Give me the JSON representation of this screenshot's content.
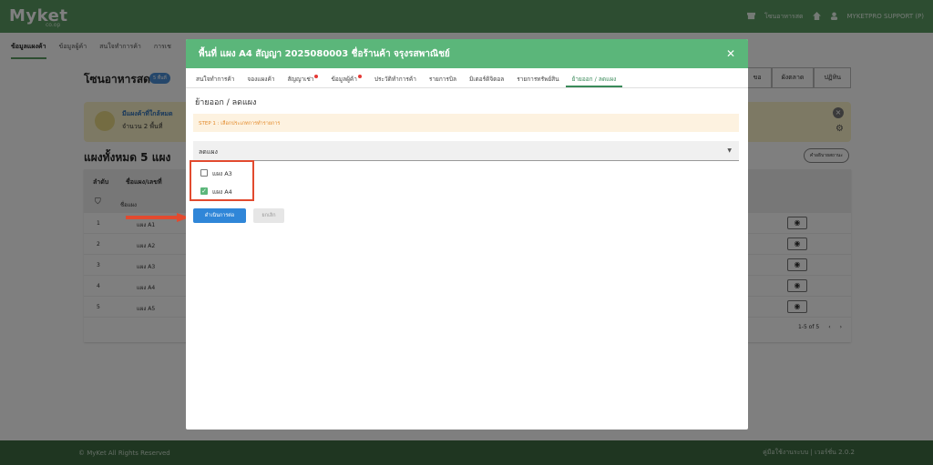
{
  "header": {
    "logo": "Myket",
    "logo_sub": "co.op",
    "shop_label": "โซนอาหารสด",
    "user_label": "MYKETPRO SUPPORT (P)",
    "store_icon": "store-icon",
    "home_icon": "home-icon",
    "user_icon": "user-icon"
  },
  "subnav": {
    "items": [
      "ข้อมูลแผงค้า",
      "ข้อมูลผู้ค้า",
      "สนใจทำการค้า",
      "การเช"
    ]
  },
  "page": {
    "title": "โซนอาหารสด",
    "badge": "5 พื้นที่",
    "segments": [
      "ขอ",
      "ผังตลาด",
      "ปฏิทิน"
    ],
    "alert_title": "มีแผงค้าที่ใกล้หมด",
    "alert_sub": "จำนวน 2 พื้นที่",
    "count_title": "แผงทั้งหมด 5 แผง",
    "help_label": "คำอธิบายสถานะ",
    "table": {
      "headers": [
        "ลำดับ",
        "ชื่อแผง/เลขที่"
      ],
      "filter_placeholder": "ชื่อแผง",
      "rows": [
        {
          "no": "1",
          "name": "แผง A1"
        },
        {
          "no": "2",
          "name": "แผง A2"
        },
        {
          "no": "3",
          "name": "แผง A3"
        },
        {
          "no": "4",
          "name": "แผง A4"
        },
        {
          "no": "5",
          "name": "แผง A5"
        }
      ],
      "pager": "1-5 of 5"
    }
  },
  "modal": {
    "title": "พื้นที่ แผง A4 สัญญา 2025080003 ชื่อร้านค้า จรุงรสพาณิชย์",
    "tabs": [
      "สนใจทำการค้า",
      "จองแผงค้า",
      "สัญญาเช่า",
      "ข้อมูลผู้ค้า",
      "ประวัติทำการค้า",
      "รายการบิล",
      "มิเตอร์ดิจิตอล",
      "รายการทรัพย์สิน",
      "ย้ายออก / ลดแผง"
    ],
    "section_title": "ย้ายออก / ลดแผง",
    "step_text": "STEP 1 : เลือกประเภทการทำรายการ",
    "select_value": "ลดแผง",
    "options": [
      {
        "label": "แผง A3",
        "checked": false
      },
      {
        "label": "แผง A4",
        "checked": true
      }
    ],
    "continue_label": "ดำเนินการต่อ",
    "cancel_label": "ยกเลิก"
  },
  "footer": {
    "left": "© MyKet All Rights Reserved",
    "right": "คู่มือใช้งานระบบ | เวอร์ชั่น 2.0.2"
  },
  "colors": {
    "brand_green": "#5a9a62",
    "modal_header": "#5bb67a",
    "primary_blue": "#2f86d8",
    "highlight_red": "#e24a2f"
  }
}
